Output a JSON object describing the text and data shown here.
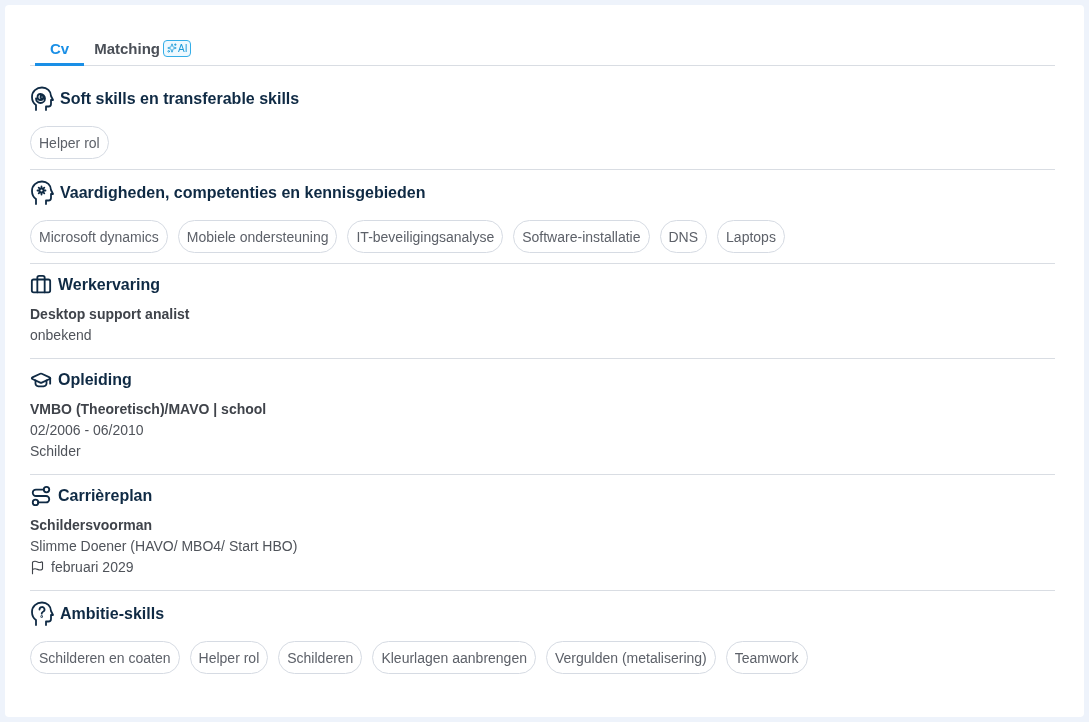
{
  "tabs": [
    {
      "label": "Cv",
      "selected": true
    },
    {
      "label": "Matching",
      "selected": false,
      "badge": "AI"
    }
  ],
  "sections": [
    {
      "kind": "tags",
      "title": "Soft skills en transferable skills",
      "tags": [
        "Helper rol"
      ]
    },
    {
      "kind": "tags",
      "title": "Vaardigheden, competenties en kennisgebieden",
      "tags": [
        "Microsoft dynamics",
        "Mobiele ondersteuning",
        "IT-beveiligingsanalyse",
        "Software-installatie",
        "DNS",
        "Laptops"
      ]
    },
    {
      "kind": "details",
      "title": "Werkervaring",
      "lines": [
        {
          "kind": "title",
          "text": "Desktop support analist"
        },
        {
          "kind": "text",
          "text": "onbekend"
        }
      ]
    },
    {
      "kind": "details",
      "title": "Opleiding",
      "lines": [
        {
          "kind": "title",
          "text": "VMBO (Theoretisch)/MAVO | school"
        },
        {
          "kind": "text",
          "text": "02/2006 - 06/2010"
        },
        {
          "kind": "text",
          "text": "Schilder"
        }
      ]
    },
    {
      "kind": "details",
      "title": "Carrièreplan",
      "lines": [
        {
          "kind": "title",
          "text": "Schildersvoorman"
        },
        {
          "kind": "text",
          "text": "Slimme Doener (HAVO/ MBO4/ Start HBO)"
        },
        {
          "kind": "goal",
          "text": "februari 2029"
        }
      ]
    },
    {
      "kind": "tags",
      "title": "Ambitie-skills",
      "tags": [
        "Schilderen en coaten",
        "Helper rol",
        "Schilderen",
        "Kleurlagen aanbrengen",
        "Vergulden (metalisering)",
        "Teamwork"
      ]
    }
  ]
}
